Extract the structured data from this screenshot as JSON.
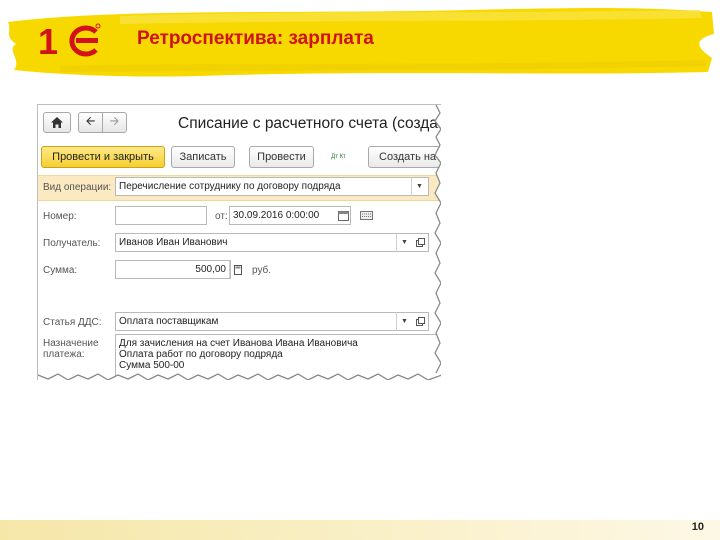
{
  "slide": {
    "title": "Ретроспектива: зарплата",
    "page_number": "10",
    "colors": {
      "accent_yellow": "#f7d900",
      "brand_red": "#d1121b"
    }
  },
  "window": {
    "title": "Списание с расчетного счета (создание)"
  },
  "toolbar": {
    "post_close_label": "Провести и закрыть",
    "save_label": "Записать",
    "post_label": "Провести",
    "dtkt_label": "Дт Кт",
    "create_basis_label": "Создать на основании"
  },
  "form": {
    "operation_label": "Вид операции:",
    "operation_value": "Перечисление сотруднику по договору подряда",
    "number_label": "Номер:",
    "number_value": "",
    "date_label": "от:",
    "date_value": "30.09.2016  0:00:00",
    "recipient_label": "Получатель:",
    "recipient_value": "Иванов Иван Иванович",
    "amount_label": "Сумма:",
    "amount_value": "500,00",
    "currency": "руб.",
    "dds_label": "Статья ДДС:",
    "dds_value": "Оплата поставщикам",
    "purpose_label_1": "Назначение",
    "purpose_label_2": "платежа:",
    "purpose_lines": [
      "Для зачисления на счет Иванова Ивана Ивановича",
      "Оплата работ по договору подряда",
      "Сумма 500-00"
    ]
  }
}
